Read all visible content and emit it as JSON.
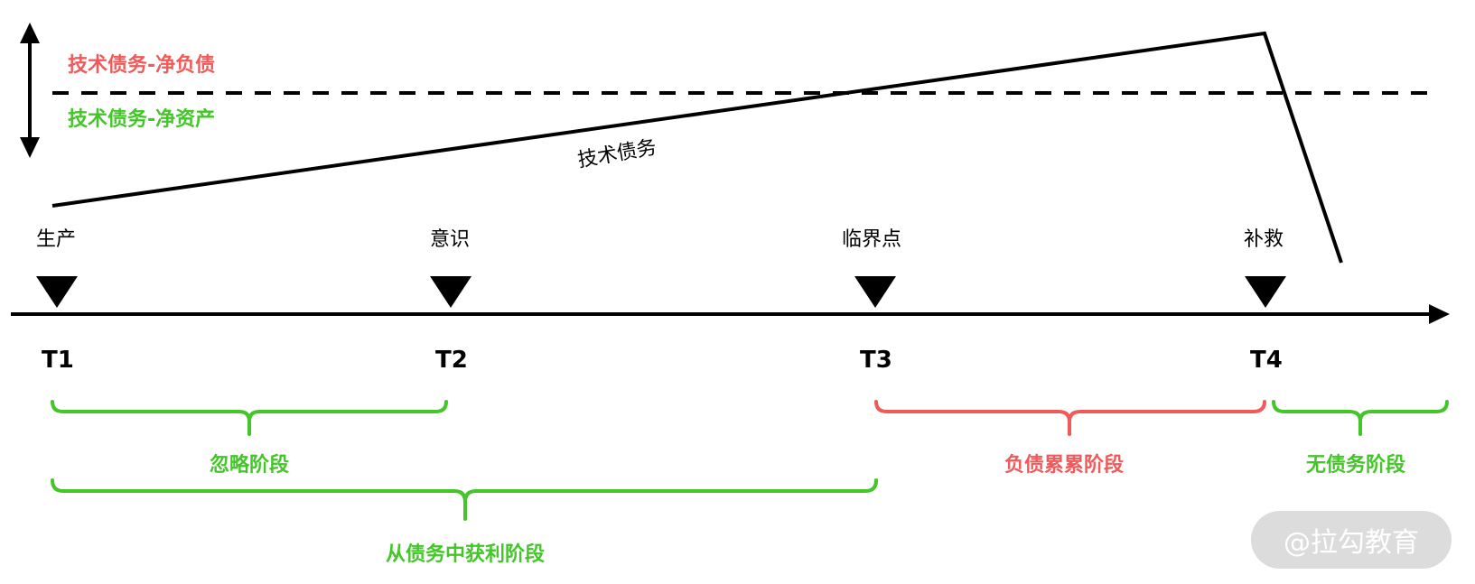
{
  "colors": {
    "liability": "#f05a5a",
    "asset": "#44c52a",
    "line": "#000000",
    "watermark_bg": "#dcdcdc"
  },
  "legend": {
    "net_liability": "技术债务-净负债",
    "net_asset": "技术债务-净资产"
  },
  "debt_line_label": "技术债务",
  "events": [
    {
      "label": "生产",
      "time": "T1"
    },
    {
      "label": "意识",
      "time": "T2"
    },
    {
      "label": "临界点",
      "time": "T3"
    },
    {
      "label": "补救",
      "time": "T4"
    }
  ],
  "phases": {
    "ignore": "忽略阶段",
    "profit": "从债务中获利阶段",
    "accumulate": "负债累累阶段",
    "no_debt": "无债务阶段"
  },
  "watermark": "@拉勾教育"
}
